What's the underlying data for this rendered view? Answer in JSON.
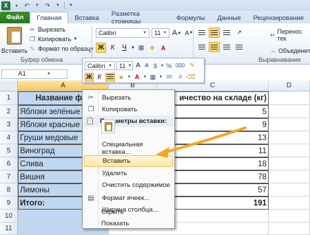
{
  "ribbon_tabs": [
    "Файл",
    "Главная",
    "Вставка",
    "Разметка страницы",
    "Формулы",
    "Данные",
    "Рецензирование"
  ],
  "clipboard": {
    "paste_label": "Вставить",
    "cut_label": "Вырезать",
    "copy_label": "Копировать",
    "format_painter_label": "Формат по образцу",
    "group_label": "Буфер обмена"
  },
  "font": {
    "name": "Calibri",
    "size": "11",
    "grow": "A",
    "shrink": "A",
    "bold": "Ж",
    "italic": "К",
    "underline": "Ч"
  },
  "alignment": {
    "wrap_label": "Перенос тек",
    "merge_label": "Объединит",
    "group_label": "Выравнивание"
  },
  "namebox": "A1",
  "columns": [
    "A",
    "B",
    "C",
    "D"
  ],
  "rows": [
    "1",
    "2",
    "3",
    "4",
    "5",
    "6",
    "7",
    "8",
    "9",
    "10",
    "11",
    "12"
  ],
  "table": {
    "header_a": "Название фру",
    "header_c": "ичество на складе (кг)",
    "items": [
      {
        "name": "Яблоки зелёные",
        "qty": "5"
      },
      {
        "name": "Яблоки красные",
        "qty": "9"
      },
      {
        "name": "Груши медовые",
        "qty": "13"
      },
      {
        "name": "Виноград",
        "qty": "11"
      },
      {
        "name": "Слива",
        "qty": "18"
      },
      {
        "name": "Вишня",
        "qty": "78"
      },
      {
        "name": "Лимоны",
        "qty": "57"
      }
    ],
    "total_label": "Итого:",
    "total_value": "191"
  },
  "mini_toolbar": {
    "font": "Calibri",
    "size": "11",
    "percent": "%",
    "thousands": "000"
  },
  "context_menu": {
    "cut": "Вырезать",
    "copy": "Копировать",
    "paste_options": "Параметры вставки:",
    "paste_special": "Специальная вставка...",
    "insert": "Вставить",
    "delete": "Удалить",
    "clear": "Очистить содержимое",
    "format_cells": "Формат ячеек...",
    "column_width": "Ширина столбца...",
    "hide": "Скрыть",
    "show": "Показать"
  },
  "colors": {
    "selection": "#bfd7f0",
    "highlight": "#fde7a6",
    "arrow": "#f5a623",
    "file_tab": "#217a1b"
  }
}
